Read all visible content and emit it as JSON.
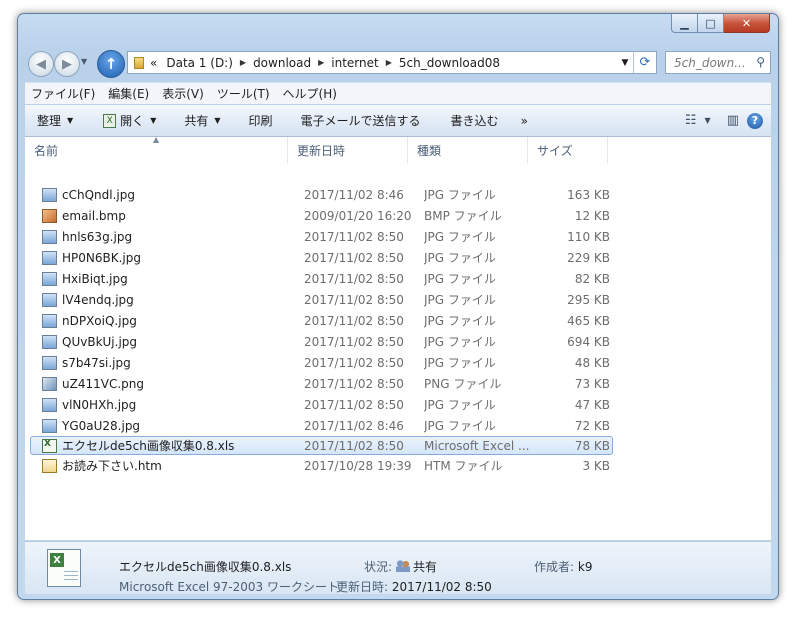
{
  "titlebar": {
    "min_glyph": "▁",
    "max_glyph": "□",
    "close_glyph": "✕"
  },
  "nav": {
    "back_glyph": "◀",
    "forward_glyph": "▶",
    "up_glyph": "↑",
    "breadcrumb_lead": "«",
    "breadcrumb": [
      "Data 1 (D:)",
      "download",
      "internet",
      "5ch_download08"
    ],
    "search_placeholder": "5ch_down..."
  },
  "menu": [
    "ファイル(F)",
    "編集(E)",
    "表示(V)",
    "ツール(T)",
    "ヘルプ(H)"
  ],
  "commands": {
    "organize": "整理",
    "open": "開く",
    "share": "共有",
    "print": "印刷",
    "email": "電子メールで送信する",
    "burn": "書き込む",
    "more": "»"
  },
  "columns": {
    "name": "名前",
    "date": "更新日時",
    "type": "種類",
    "size": "サイズ"
  },
  "files": [
    {
      "name": "cChQndl.jpg",
      "date": "2017/11/02 8:46",
      "type": "JPG ファイル",
      "size": "163 KB",
      "icon": "jpg"
    },
    {
      "name": "email.bmp",
      "date": "2009/01/20 16:20",
      "type": "BMP ファイル",
      "size": "12 KB",
      "icon": "bmp"
    },
    {
      "name": "hnls63g.jpg",
      "date": "2017/11/02 8:50",
      "type": "JPG ファイル",
      "size": "110 KB",
      "icon": "jpg"
    },
    {
      "name": "HP0N6BK.jpg",
      "date": "2017/11/02 8:50",
      "type": "JPG ファイル",
      "size": "229 KB",
      "icon": "jpg"
    },
    {
      "name": "HxiBiqt.jpg",
      "date": "2017/11/02 8:50",
      "type": "JPG ファイル",
      "size": "82 KB",
      "icon": "jpg"
    },
    {
      "name": "lV4endq.jpg",
      "date": "2017/11/02 8:50",
      "type": "JPG ファイル",
      "size": "295 KB",
      "icon": "jpg"
    },
    {
      "name": "nDPXoiQ.jpg",
      "date": "2017/11/02 8:50",
      "type": "JPG ファイル",
      "size": "465 KB",
      "icon": "jpg"
    },
    {
      "name": "QUvBkUj.jpg",
      "date": "2017/11/02 8:50",
      "type": "JPG ファイル",
      "size": "694 KB",
      "icon": "jpg"
    },
    {
      "name": "s7b47si.jpg",
      "date": "2017/11/02 8:50",
      "type": "JPG ファイル",
      "size": "48 KB",
      "icon": "jpg"
    },
    {
      "name": "uZ411VC.png",
      "date": "2017/11/02 8:50",
      "type": "PNG ファイル",
      "size": "73 KB",
      "icon": "png"
    },
    {
      "name": "vlN0HXh.jpg",
      "date": "2017/11/02 8:50",
      "type": "JPG ファイル",
      "size": "47 KB",
      "icon": "jpg"
    },
    {
      "name": "YG0aU28.jpg",
      "date": "2017/11/02 8:46",
      "type": "JPG ファイル",
      "size": "72 KB",
      "icon": "jpg"
    },
    {
      "name": "エクセルde5ch画像収集0.8.xls",
      "date": "2017/11/02 8:50",
      "type": "Microsoft Excel ...",
      "size": "78 KB",
      "icon": "xls",
      "selected": true
    },
    {
      "name": "お読み下さい.htm",
      "date": "2017/10/28 19:39",
      "type": "HTM ファイル",
      "size": "3 KB",
      "icon": "htm"
    }
  ],
  "details": {
    "name": "エクセルde5ch画像収集0.8.xls",
    "type": "Microsoft Excel 97-2003 ワークシート",
    "status_label": "状況:",
    "status_value": "共有",
    "modified_label": "更新日時:",
    "modified_value": "2017/11/02 8:50",
    "author_label": "作成者:",
    "author_value": "k9"
  }
}
